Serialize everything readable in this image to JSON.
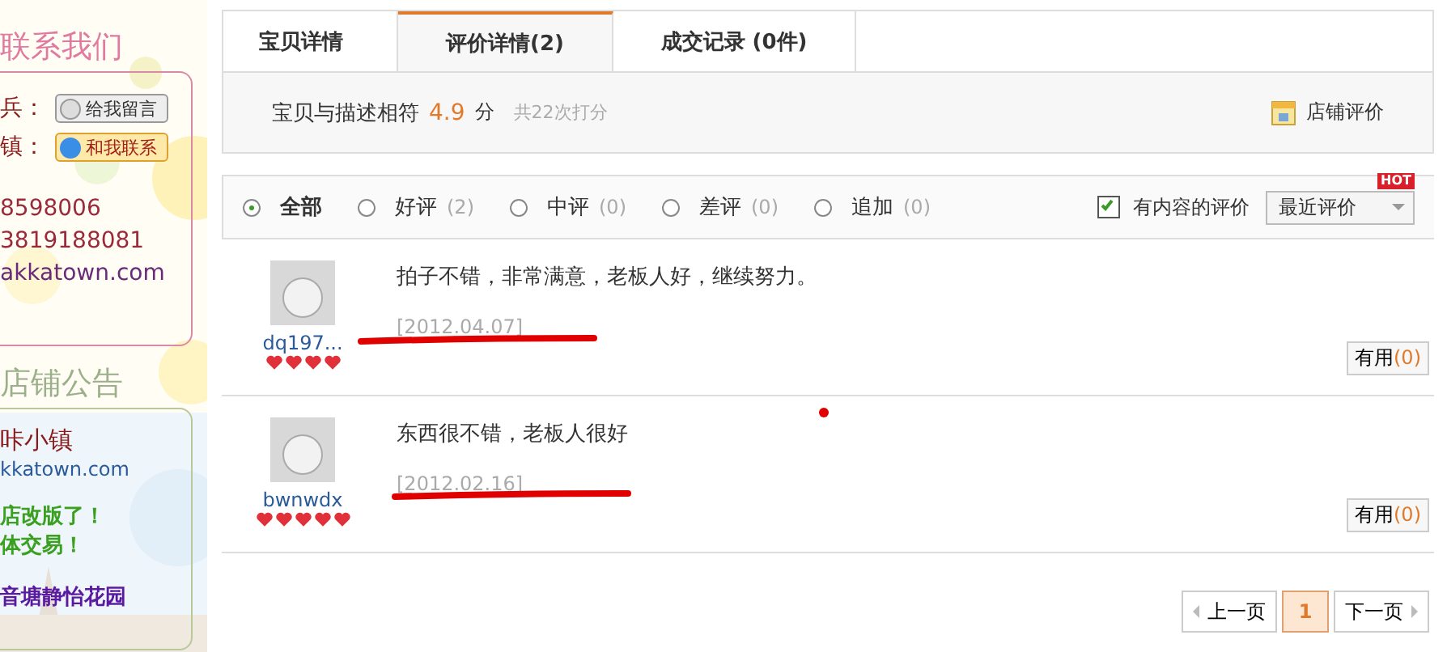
{
  "sidebar": {
    "contact": {
      "heading": "联系我们",
      "buttons": [
        {
          "prefix": "兵：",
          "label": "给我留言",
          "kind": "message"
        },
        {
          "prefix": "镇：",
          "label": "和我联系",
          "kind": "chat"
        }
      ],
      "lines": [
        "8598006",
        "3819188081",
        "akkatown.com"
      ]
    },
    "notice": {
      "heading": "店铺公告",
      "lines": [
        {
          "text": "咔小镇",
          "kind": "title"
        },
        {
          "text": "kkatown.com",
          "kind": "link"
        },
        {
          "text": "店改版了！",
          "kind": "green"
        },
        {
          "text": "体交易！",
          "kind": "green"
        },
        {
          "text": "音塘静怡花园",
          "kind": "purple"
        }
      ]
    }
  },
  "tabs": [
    {
      "label": "宝贝详情",
      "selected": false
    },
    {
      "label": "评价详情(2)",
      "selected": true
    },
    {
      "label": "成交记录 (0件)",
      "selected": false
    }
  ],
  "score": {
    "label": "宝贝与描述相符",
    "value": "4.9",
    "unit": "分",
    "count": "共22次打分",
    "shop_link": "店铺评价"
  },
  "filters": [
    {
      "label": "全部",
      "selected": true
    },
    {
      "label": "好评",
      "count": "(2)",
      "selected": false
    },
    {
      "label": "中评",
      "count": "(0)",
      "selected": false
    },
    {
      "label": "差评",
      "count": "(0)",
      "selected": false
    },
    {
      "label": "追加",
      "count": "(0)",
      "selected": false
    }
  ],
  "content_only": {
    "label": "有内容的评价",
    "checked": true
  },
  "sort": {
    "value": "最近评价",
    "badge": "HOT"
  },
  "reviews": [
    {
      "user": "dq197...",
      "stars": 4,
      "text": "拍子不错，非常满意，老板人好，继续努力。",
      "date": "[2012.04.07]",
      "useful": "有用",
      "useful_count": "(0)"
    },
    {
      "user": "bwnwdx",
      "stars": 5,
      "text": "东西很不错，老板人很好",
      "date": "[2012.02.16]",
      "useful": "有用",
      "useful_count": "(0)"
    }
  ],
  "pagination": {
    "prev": "上一页",
    "pages": [
      {
        "label": "1",
        "selected": true
      }
    ],
    "next": "下一页"
  }
}
